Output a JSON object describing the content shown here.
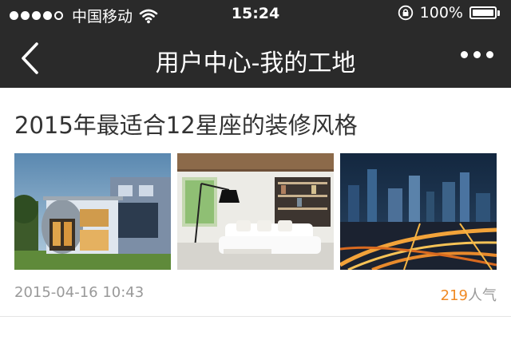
{
  "status_bar": {
    "carrier": "中国移动",
    "time": "15:24",
    "battery": "100%",
    "battery_level": 1.0,
    "signal_bars_filled": 4,
    "signal_bars_total": 5
  },
  "nav": {
    "title": "用户中心-我的工地",
    "back_icon": "chevron-left-icon",
    "more_icon": "more-dots-icon"
  },
  "article": {
    "title": "2015年最适合12星座的装修风格",
    "images": [
      "modern-villa-photo",
      "white-living-room-photo",
      "city-night-aerial-photo"
    ],
    "date": "2015-04-16 10:43",
    "views": "219",
    "views_label": "人气"
  },
  "colors": {
    "header_bg": "#2a2a2a",
    "accent": "#f08a24",
    "meta_text": "#999999",
    "title_text": "#333333"
  }
}
